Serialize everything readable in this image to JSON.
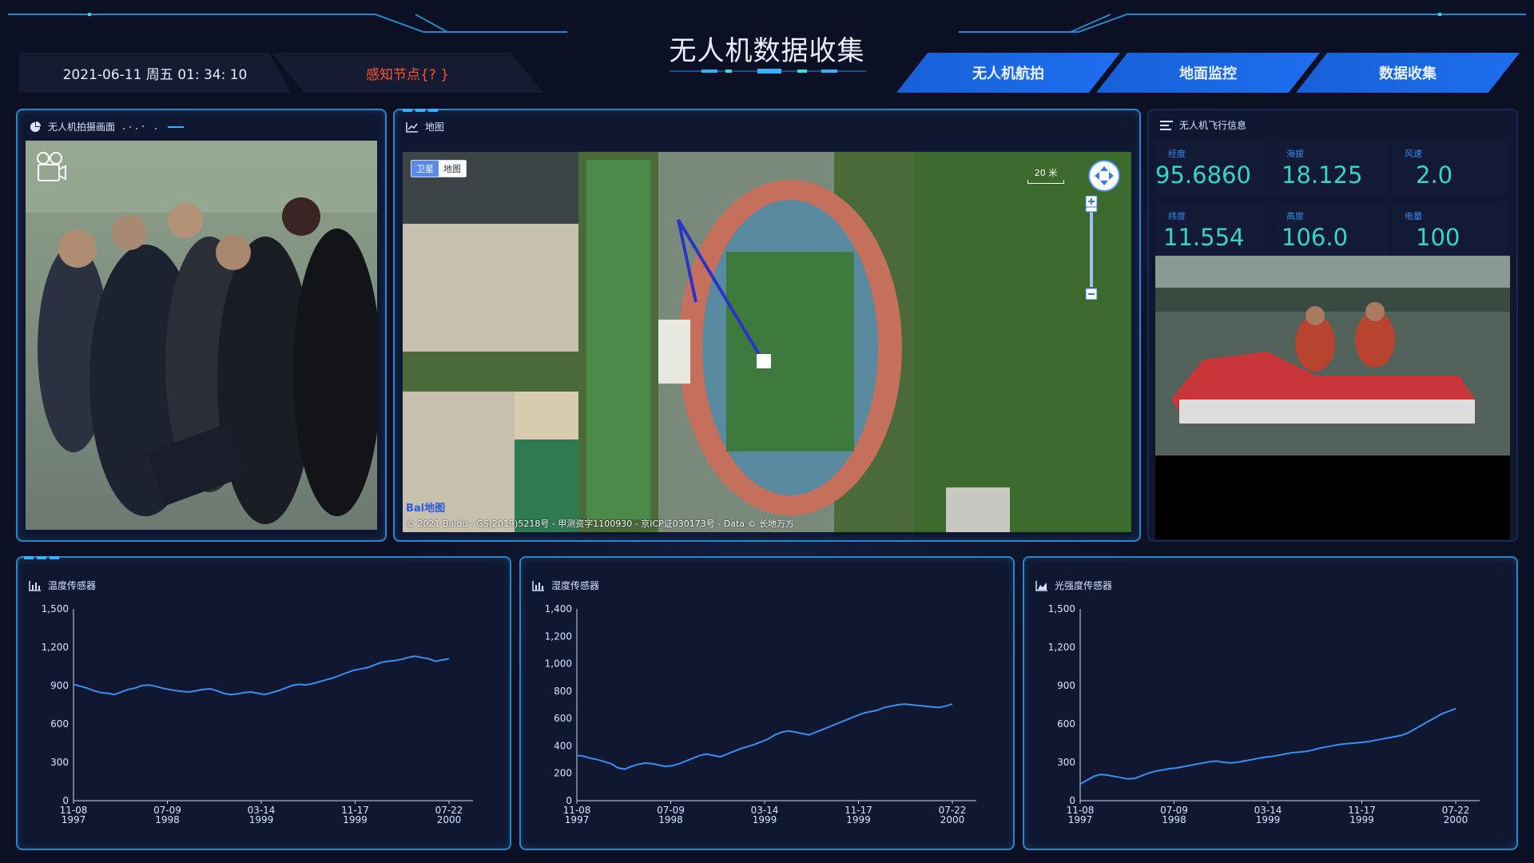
{
  "header": {
    "title": "无人机数据收集",
    "datetime": "2021-06-11 周五 01: 34: 10",
    "node_status": "感知节点{? }",
    "nav": [
      "无人机航拍",
      "地面监控",
      "数据收集"
    ]
  },
  "video_panel": {
    "title": "无人机拍摄画面"
  },
  "map_panel": {
    "title": "地图",
    "toggle": {
      "satellite": "卫星",
      "map": "地图"
    },
    "scale": "20 米",
    "logo": "Bai地图",
    "copyright": "© 2021 Baidu - GS(2019)5218号 - 甲测资字1100930 - 京ICP证030173号 - Data © 长地万方"
  },
  "flight_panel": {
    "title": "无人机飞行信息",
    "stats": [
      {
        "label": "经度",
        "value": "95.6860"
      },
      {
        "label": "海拔",
        "value": "18.125"
      },
      {
        "label": "风速",
        "value": "2.0"
      },
      {
        "label": "纬度",
        "value": "11.554"
      },
      {
        "label": "高度",
        "value": "106.0"
      },
      {
        "label": "电量",
        "value": "100"
      }
    ]
  },
  "colors": {
    "accent": "#1e6ef0",
    "stat_value": "#36d6c2",
    "line": "#3a8ef6",
    "alert": "#ff5533"
  },
  "chart_data": [
    {
      "type": "line",
      "title": "温度传感器",
      "x_ticks": [
        "11-08\n1997",
        "07-09\n1998",
        "03-14\n1999",
        "11-17\n1999",
        "07-22\n2000"
      ],
      "y_ticks": [
        "1,500",
        "1,200",
        "900",
        "600",
        "300",
        "0"
      ],
      "ylim": [
        0,
        1500
      ],
      "series": [
        {
          "values": [
            910,
            895,
            880,
            860,
            845,
            840,
            830,
            850,
            870,
            880,
            900,
            905,
            895,
            880,
            870,
            860,
            855,
            850,
            860,
            870,
            875,
            860,
            840,
            830,
            835,
            845,
            850,
            840,
            830,
            845,
            860,
            880,
            900,
            910,
            905,
            915,
            930,
            945,
            960,
            980,
            1000,
            1020,
            1030,
            1040,
            1060,
            1080,
            1090,
            1095,
            1105,
            1120,
            1130,
            1120,
            1110,
            1090,
            1100,
            1110
          ]
        }
      ]
    },
    {
      "type": "line",
      "title": "湿度传感器",
      "x_ticks": [
        "11-08\n1997",
        "07-09\n1998",
        "03-14\n1999",
        "11-17\n1999",
        "07-22\n2000"
      ],
      "y_ticks": [
        "1,400",
        "1,200",
        "1,000",
        "800",
        "600",
        "400",
        "200",
        "0"
      ],
      "ylim": [
        0,
        1400
      ],
      "series": [
        {
          "values": [
            330,
            325,
            310,
            300,
            285,
            270,
            240,
            230,
            250,
            265,
            275,
            270,
            260,
            250,
            255,
            270,
            290,
            310,
            330,
            340,
            330,
            320,
            340,
            360,
            380,
            395,
            410,
            430,
            450,
            480,
            500,
            510,
            500,
            490,
            480,
            500,
            520,
            540,
            560,
            580,
            600,
            620,
            640,
            650,
            660,
            680,
            690,
            700,
            705,
            700,
            695,
            690,
            685,
            680,
            690,
            705
          ]
        }
      ]
    },
    {
      "type": "line",
      "title": "光强度传感器",
      "x_ticks": [
        "11-08\n1997",
        "07-09\n1998",
        "03-14\n1999",
        "11-17\n1999",
        "07-22\n2000"
      ],
      "y_ticks": [
        "1,500",
        "1,200",
        "900",
        "600",
        "300",
        "0"
      ],
      "ylim": [
        0,
        1500
      ],
      "series": [
        {
          "values": [
            130,
            160,
            190,
            205,
            200,
            190,
            180,
            170,
            175,
            195,
            215,
            230,
            240,
            250,
            255,
            265,
            275,
            285,
            295,
            305,
            310,
            300,
            295,
            300,
            310,
            320,
            330,
            340,
            345,
            355,
            365,
            375,
            380,
            385,
            395,
            410,
            420,
            430,
            440,
            445,
            450,
            455,
            460,
            470,
            480,
            490,
            500,
            510,
            530,
            560,
            590,
            620,
            650,
            680,
            700,
            720
          ]
        }
      ]
    }
  ]
}
